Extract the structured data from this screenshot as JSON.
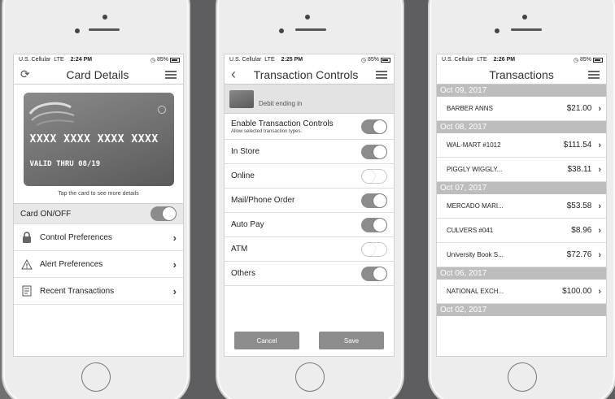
{
  "status": {
    "carrier": "U.S. Cellular",
    "network": "LTE",
    "battery": "85%"
  },
  "screen1": {
    "time": "2:24 PM",
    "title": "Card Details",
    "card_number": "XXXX XXXX XXXX XXXX",
    "valid_thru": "VALID THRU 08/19",
    "tap_hint": "Tap the card to see more details",
    "onoff_label": "Card ON/OFF",
    "menu": [
      {
        "label": "Control Preferences",
        "icon": "lock-icon"
      },
      {
        "label": "Alert Preferences",
        "icon": "warning-icon"
      },
      {
        "label": "Recent Transactions",
        "icon": "receipt-icon"
      }
    ]
  },
  "screen2": {
    "time": "2:25 PM",
    "title": "Transaction Controls",
    "debit_label": "Debit ending in",
    "enable_label": "Enable Transaction Controls",
    "enable_sub": "Allow selected transaction types.",
    "controls": [
      {
        "label": "In Store",
        "on": true
      },
      {
        "label": "Online",
        "on": false
      },
      {
        "label": "Mail/Phone Order",
        "on": true
      },
      {
        "label": "Auto Pay",
        "on": true
      },
      {
        "label": "ATM",
        "on": false
      },
      {
        "label": "Others",
        "on": true
      }
    ],
    "cancel_label": "Cancel",
    "save_label": "Save"
  },
  "screen3": {
    "time": "2:26 PM",
    "title": "Transactions",
    "groups": [
      {
        "date": "Oct 09, 2017",
        "items": [
          {
            "name": "BARBER ANNS",
            "amount": "$21.00"
          }
        ]
      },
      {
        "date": "Oct 08, 2017",
        "items": [
          {
            "name": "WAL-MART #1012",
            "amount": "$111.54"
          },
          {
            "name": "PIGGLY WIGGLY...",
            "amount": "$38.11"
          }
        ]
      },
      {
        "date": "Oct 07, 2017",
        "items": [
          {
            "name": "MERCADO MARI...",
            "amount": "$53.58"
          },
          {
            "name": "CULVERS #041",
            "amount": "$8.96"
          },
          {
            "name": "University Book S...",
            "amount": "$72.76"
          }
        ]
      },
      {
        "date": "Oct 06, 2017",
        "items": [
          {
            "name": "NATIONAL EXCH...",
            "amount": "$100.00"
          }
        ]
      },
      {
        "date": "Oct 02, 2017",
        "items": []
      }
    ]
  },
  "colors": {
    "background": "#5e5e60",
    "accent_gray": "#8c8c8c",
    "date_header": "#bdbdbd"
  }
}
